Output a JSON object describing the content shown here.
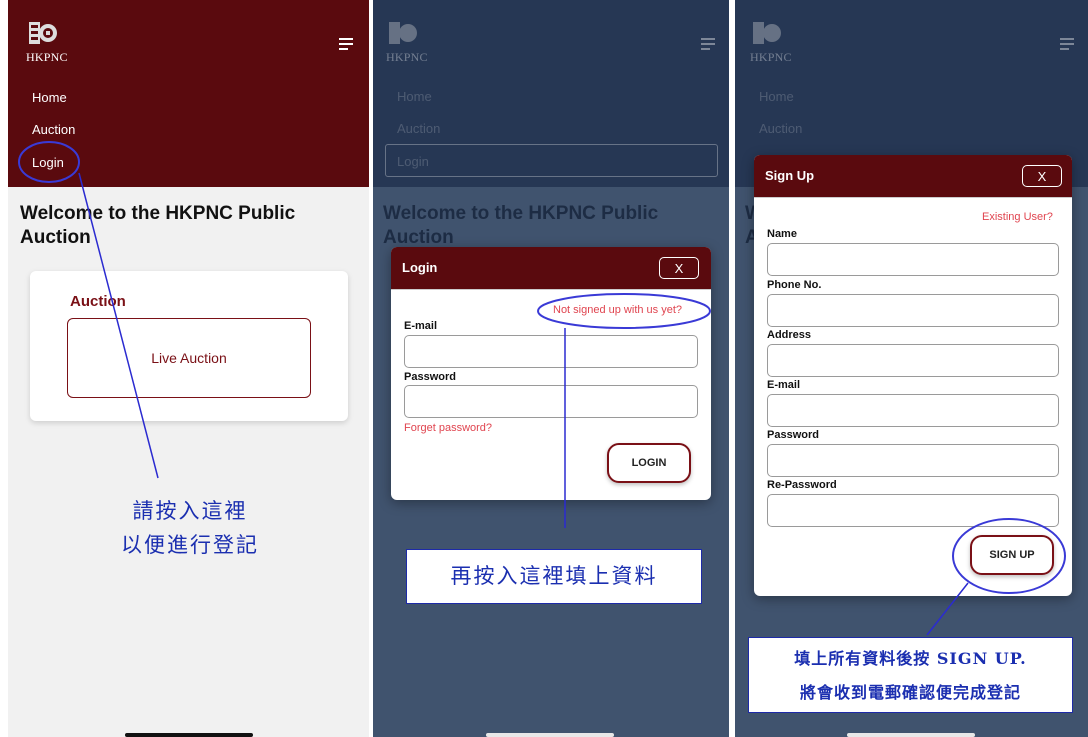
{
  "logo": {
    "text": "HKPNC"
  },
  "nav": {
    "home": "Home",
    "auction": "Auction",
    "login": "Login"
  },
  "welcome": "Welcome to the HKPNC Public Auction",
  "card": {
    "title": "Auction",
    "live_button": "Live Auction"
  },
  "login_modal": {
    "title": "Login",
    "close": "X",
    "signup_link": "Not signed up with us yet?",
    "email_label": "E-mail",
    "password_label": "Password",
    "forgot_link": "Forget password?",
    "submit": "LOGIN"
  },
  "signup_modal": {
    "title": "Sign Up",
    "close": "X",
    "existing_link": "Existing User?",
    "fields": [
      "Name",
      "Phone No.",
      "Address",
      "E-mail",
      "Password",
      "Re-Password"
    ],
    "submit": "SIGN UP"
  },
  "annotations": {
    "step1_line1": "請按入這裡",
    "step1_line2": "以便進行登記",
    "step2": "再按入這裡填上資料",
    "step3_line1": "填上所有資料後按 SIGN UP.",
    "step3_line2": "將會收到電郵確認便完成登記"
  },
  "colors": {
    "brand": "#5a0a0e",
    "dim_header": "#263754",
    "dim_body": "#40536e",
    "link": "#e0444f",
    "annotation": "#1b2fb0"
  }
}
